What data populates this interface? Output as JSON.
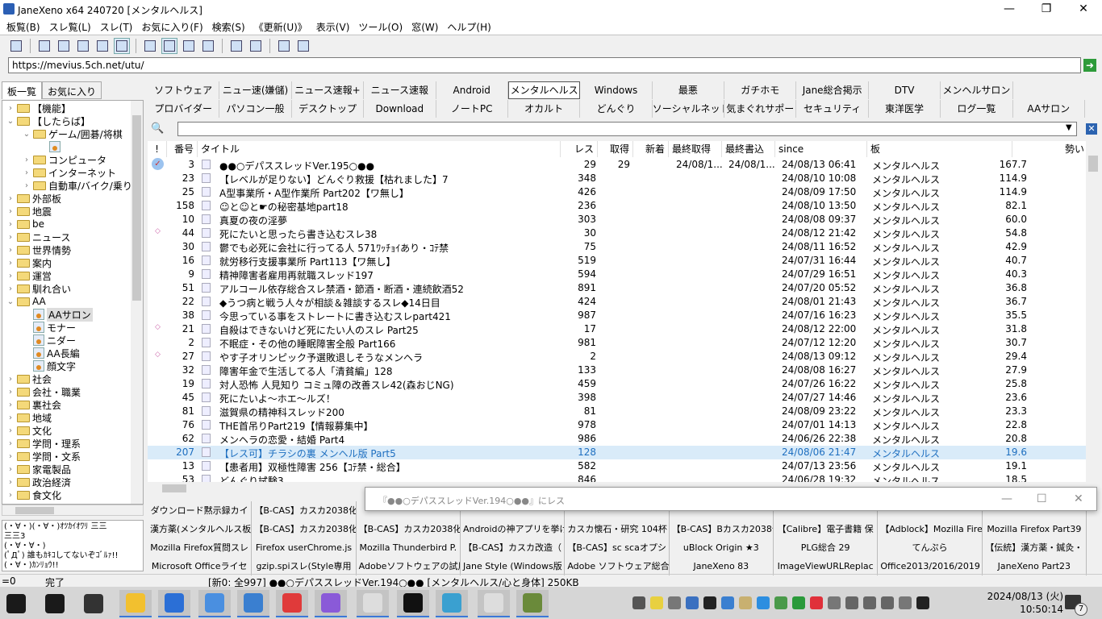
{
  "window": {
    "title": "JaneXeno x64 240720 [メンタルヘルス]",
    "minimize": "—",
    "maximize": "❐",
    "close": "✕"
  },
  "menu": [
    "板覧(B)",
    "スレ覧(L)",
    "スレ(T)",
    "お気に入り(F)",
    "検索(S)",
    "《更新(U)》",
    "表示(V)",
    "ツール(O)",
    "窓(W)",
    "ヘルプ(H)"
  ],
  "address": {
    "url": "https://mevius.5ch.net/utu/",
    "go": "➜"
  },
  "left_tabs": [
    {
      "label": "板一覧",
      "active": true
    },
    {
      "label": "お気に入り",
      "active": false
    }
  ],
  "tree": [
    {
      "label": "【機能】",
      "level": 0,
      "type": "folder",
      "state": "collapsed"
    },
    {
      "label": "【したらば】",
      "level": 0,
      "type": "folder",
      "state": "expanded"
    },
    {
      "label": "ゲーム/囲碁/将棋",
      "level": 1,
      "type": "folder",
      "state": "expanded"
    },
    {
      "label": "",
      "level": 2,
      "type": "board",
      "state": "none"
    },
    {
      "label": "コンピュータ",
      "level": 1,
      "type": "folder",
      "state": "collapsed"
    },
    {
      "label": "インターネット",
      "level": 1,
      "type": "folder",
      "state": "collapsed"
    },
    {
      "label": "自動車/バイク/乗り",
      "level": 1,
      "type": "folder",
      "state": "collapsed"
    },
    {
      "label": "外部板",
      "level": 0,
      "type": "folder",
      "state": "collapsed"
    },
    {
      "label": "地震",
      "level": 0,
      "type": "folder",
      "state": "collapsed"
    },
    {
      "label": "be",
      "level": 0,
      "type": "folder",
      "state": "collapsed"
    },
    {
      "label": "ニュース",
      "level": 0,
      "type": "folder",
      "state": "collapsed"
    },
    {
      "label": "世界情勢",
      "level": 0,
      "type": "folder",
      "state": "collapsed"
    },
    {
      "label": "案内",
      "level": 0,
      "type": "folder",
      "state": "collapsed"
    },
    {
      "label": "運営",
      "level": 0,
      "type": "folder",
      "state": "collapsed"
    },
    {
      "label": "馴れ合い",
      "level": 0,
      "type": "folder",
      "state": "collapsed"
    },
    {
      "label": "AA",
      "level": 0,
      "type": "folder",
      "state": "expanded"
    },
    {
      "label": "AAサロン",
      "level": 1,
      "type": "board",
      "state": "selected"
    },
    {
      "label": "モナー",
      "level": 1,
      "type": "board",
      "state": "none"
    },
    {
      "label": "ニダー",
      "level": 1,
      "type": "board",
      "state": "none"
    },
    {
      "label": "AA長編",
      "level": 1,
      "type": "board",
      "state": "none"
    },
    {
      "label": "顔文字",
      "level": 1,
      "type": "board",
      "state": "none"
    },
    {
      "label": "社会",
      "level": 0,
      "type": "folder",
      "state": "collapsed"
    },
    {
      "label": "会社・職業",
      "level": 0,
      "type": "folder",
      "state": "collapsed"
    },
    {
      "label": "裏社会",
      "level": 0,
      "type": "folder",
      "state": "collapsed"
    },
    {
      "label": "地域",
      "level": 0,
      "type": "folder",
      "state": "collapsed"
    },
    {
      "label": "文化",
      "level": 0,
      "type": "folder",
      "state": "collapsed"
    },
    {
      "label": "学問・理系",
      "level": 0,
      "type": "folder",
      "state": "collapsed"
    },
    {
      "label": "学問・文系",
      "level": 0,
      "type": "folder",
      "state": "collapsed"
    },
    {
      "label": "家電製品",
      "level": 0,
      "type": "folder",
      "state": "collapsed"
    },
    {
      "label": "政治経済",
      "level": 0,
      "type": "folder",
      "state": "collapsed"
    },
    {
      "label": "食文化",
      "level": 0,
      "type": "folder",
      "state": "collapsed"
    }
  ],
  "aa_text": "(・∀・)(・∀・)ｵﾂｶｲｵﾜﾘ 三三\n三三3\n(・∀・∀・)\n(ﾟДﾟ) 誰もｶｷｺしてないぞｺﾞﾙｧ!!\n(・∀・)ｶﾝﾘｮｳ!!",
  "board_tabs": {
    "row1": [
      "ソフトウェア",
      "ニュー速(嫌儲)",
      "ニュース速報+",
      "ニュース速報",
      "Android",
      "メンタルヘルス",
      "Windows",
      "最悪",
      "ガチホモ",
      "Jane総合掲示",
      "DTV",
      "メンヘルサロン"
    ],
    "row2": [
      "プロバイダー",
      "パソコン一般",
      "デスクトップ",
      "Download",
      "ノートPC",
      "オカルト",
      "どんぐり",
      "ソーシャルネット",
      "気まぐれサポー",
      "セキュリティ",
      "東洋医学",
      "ログ一覧",
      "AAサロン"
    ],
    "active": "メンタルヘルス"
  },
  "search": {
    "value": "",
    "placeholder": ""
  },
  "columns": [
    "!",
    "番号",
    "タイトル",
    "レス",
    "取得",
    "新着",
    "最終取得",
    "最終書込",
    "since",
    "板",
    "勢い"
  ],
  "threads": [
    {
      "mark": "check",
      "no": "3",
      "title": "●●○デパススレッドVer.195○●●",
      "res": "29",
      "got": "29",
      "new": "",
      "last_get": "24/08/1...",
      "last_write": "24/08/1...",
      "since": "24/08/13 06:41",
      "board": "メンタルヘルス",
      "ikioi": "167.7"
    },
    {
      "mark": "",
      "no": "23",
      "title": "【レベルが足りない】どんぐり救援【枯れました】7",
      "res": "348",
      "got": "",
      "new": "",
      "last_get": "",
      "last_write": "",
      "since": "24/08/10 10:08",
      "board": "メンタルヘルス",
      "ikioi": "114.9"
    },
    {
      "mark": "",
      "no": "25",
      "title": "A型事業所・A型作業所 Part202【ワ無し】",
      "res": "426",
      "got": "",
      "new": "",
      "last_get": "",
      "last_write": "",
      "since": "24/08/09 17:50",
      "board": "メンタルヘルス",
      "ikioi": "114.9"
    },
    {
      "mark": "",
      "no": "158",
      "title": "☺と☺と☛の秘密基地part18",
      "res": "236",
      "got": "",
      "new": "",
      "last_get": "",
      "last_write": "",
      "since": "24/08/10 13:50",
      "board": "メンタルヘルス",
      "ikioi": "82.1"
    },
    {
      "mark": "",
      "no": "10",
      "title": "真夏の夜の淫夢",
      "res": "303",
      "got": "",
      "new": "",
      "last_get": "",
      "last_write": "",
      "since": "24/08/08 09:37",
      "board": "メンタルヘルス",
      "ikioi": "60.0"
    },
    {
      "mark": "new",
      "no": "44",
      "title": "死にたいと思ったら書き込むスレ38",
      "res": "30",
      "got": "",
      "new": "",
      "last_get": "",
      "last_write": "",
      "since": "24/08/12 21:42",
      "board": "メンタルヘルス",
      "ikioi": "54.8"
    },
    {
      "mark": "",
      "no": "30",
      "title": "鬱でも必死に会社に行ってる人 571ﾜｯﾁｮｲあり・ｺﾃ禁",
      "res": "75",
      "got": "",
      "new": "",
      "last_get": "",
      "last_write": "",
      "since": "24/08/11 16:52",
      "board": "メンタルヘルス",
      "ikioi": "42.9"
    },
    {
      "mark": "",
      "no": "16",
      "title": "就労移行支援事業所 Part113【ワ無し】",
      "res": "519",
      "got": "",
      "new": "",
      "last_get": "",
      "last_write": "",
      "since": "24/07/31 16:44",
      "board": "メンタルヘルス",
      "ikioi": "40.7"
    },
    {
      "mark": "",
      "no": "9",
      "title": "精神障害者雇用再就職スレッド197",
      "res": "594",
      "got": "",
      "new": "",
      "last_get": "",
      "last_write": "",
      "since": "24/07/29 16:51",
      "board": "メンタルヘルス",
      "ikioi": "40.3"
    },
    {
      "mark": "",
      "no": "51",
      "title": "アルコール依存総合スレ禁酒・節酒・断酒・連続飲酒52",
      "res": "891",
      "got": "",
      "new": "",
      "last_get": "",
      "last_write": "",
      "since": "24/07/20 05:52",
      "board": "メンタルヘルス",
      "ikioi": "36.8"
    },
    {
      "mark": "",
      "no": "22",
      "title": "◆うつ病と戦う人々が相談＆雑談するスレ◆14日目",
      "res": "424",
      "got": "",
      "new": "",
      "last_get": "",
      "last_write": "",
      "since": "24/08/01 21:43",
      "board": "メンタルヘルス",
      "ikioi": "36.7"
    },
    {
      "mark": "",
      "no": "38",
      "title": "今思っている事をストレートに書き込むスレpart421",
      "res": "987",
      "got": "",
      "new": "",
      "last_get": "",
      "last_write": "",
      "since": "24/07/16 16:23",
      "board": "メンタルヘルス",
      "ikioi": "35.5"
    },
    {
      "mark": "new",
      "no": "21",
      "title": "自殺はできないけど死にたい人のスレ Part25",
      "res": "17",
      "got": "",
      "new": "",
      "last_get": "",
      "last_write": "",
      "since": "24/08/12 22:00",
      "board": "メンタルヘルス",
      "ikioi": "31.8"
    },
    {
      "mark": "",
      "no": "2",
      "title": "不眠症・その他の睡眠障害全般 Part166",
      "res": "981",
      "got": "",
      "new": "",
      "last_get": "",
      "last_write": "",
      "since": "24/07/12 12:20",
      "board": "メンタルヘルス",
      "ikioi": "30.7"
    },
    {
      "mark": "new",
      "no": "27",
      "title": "やす子オリンピック予選敗退しそうなメンヘラ",
      "res": "2",
      "got": "",
      "new": "",
      "last_get": "",
      "last_write": "",
      "since": "24/08/13 09:12",
      "board": "メンタルヘルス",
      "ikioi": "29.4"
    },
    {
      "mark": "",
      "no": "32",
      "title": "障害年金で生活してる人「清貧編」128",
      "res": "133",
      "got": "",
      "new": "",
      "last_get": "",
      "last_write": "",
      "since": "24/08/08 16:27",
      "board": "メンタルヘルス",
      "ikioi": "27.9"
    },
    {
      "mark": "",
      "no": "19",
      "title": "対人恐怖 人見知り コミュ障の改善スレ42(森おじNG)",
      "res": "459",
      "got": "",
      "new": "",
      "last_get": "",
      "last_write": "",
      "since": "24/07/26 16:22",
      "board": "メンタルヘルス",
      "ikioi": "25.8"
    },
    {
      "mark": "",
      "no": "45",
      "title": "死にたいよ～ホエ～ルズ！",
      "res": "398",
      "got": "",
      "new": "",
      "last_get": "",
      "last_write": "",
      "since": "24/07/27 14:46",
      "board": "メンタルヘルス",
      "ikioi": "23.6"
    },
    {
      "mark": "",
      "no": "81",
      "title": "滋賀県の精神科スレッド200",
      "res": "81",
      "got": "",
      "new": "",
      "last_get": "",
      "last_write": "",
      "since": "24/08/09 23:22",
      "board": "メンタルヘルス",
      "ikioi": "23.3"
    },
    {
      "mark": "",
      "no": "76",
      "title": "THE首吊りPart219【情報募集中】",
      "res": "978",
      "got": "",
      "new": "",
      "last_get": "",
      "last_write": "",
      "since": "24/07/01 14:13",
      "board": "メンタルヘルス",
      "ikioi": "22.8"
    },
    {
      "mark": "",
      "no": "62",
      "title": "メンヘラの恋愛・結婚 Part4",
      "res": "986",
      "got": "",
      "new": "",
      "last_get": "",
      "last_write": "",
      "since": "24/06/26 22:38",
      "board": "メンタルヘルス",
      "ikioi": "20.8"
    },
    {
      "mark": "hover",
      "no": "207",
      "title": "【レス可】チラシの裏 メンヘル版 Part5",
      "res": "128",
      "got": "",
      "new": "",
      "last_get": "",
      "last_write": "",
      "since": "24/08/06 21:47",
      "board": "メンタルヘルス",
      "ikioi": "19.6"
    },
    {
      "mark": "",
      "no": "13",
      "title": "【患者用】双極性障害 256【ｺﾃ禁・総合】",
      "res": "582",
      "got": "",
      "new": "",
      "last_get": "",
      "last_write": "",
      "since": "24/07/13 23:56",
      "board": "メンタルヘルス",
      "ikioi": "19.1"
    },
    {
      "mark": "",
      "no": "53",
      "title": "どんぐり試験3",
      "res": "846",
      "got": "",
      "new": "",
      "last_get": "",
      "last_write": "",
      "since": "24/06/28 19:32",
      "board": "メンタルヘルス",
      "ikioi": "18.5"
    }
  ],
  "popup": {
    "title": "『●●○デパススレッドVer.194○●●』にレス",
    "minimize": "—",
    "maximize": "☐",
    "close": "✕"
  },
  "thread_tabs": [
    [
      "ダウンロード黙示録カイ",
      "【B-CAS】カスカ2038化",
      "",
      "",
      "",
      "",
      "",
      "",
      ""
    ],
    [
      "漢方薬(メンタルヘルス板",
      "【B-CAS】カスカ2038化",
      "【B-CAS】カスカ2038化",
      "Androidの神アプリを挙げ",
      "カスカ懐石・研究 104杯",
      "【B-CAS】Bカスカ2038化",
      "【Calibre】電子書籍 保",
      "【Adblock】Mozilla Fire",
      "Mozilla Firefox Part39"
    ],
    [
      "Mozilla Firefox質問スレ",
      "Firefox userChrome.js",
      "Mozilla Thunderbird P.",
      "【B-CAS】カスカ改造（",
      "【B-CAS】sc scaオプシ",
      "uBlock Origin ★3",
      "PLG総合 29",
      "てんぷら",
      "【伝統】漢方薬・鍼灸・"
    ],
    [
      "Microsoft Officeライセ",
      "gzip.spiスレ(Style専用",
      "Adobeソフトウェアの試用",
      "Jane Style (Windows版",
      "Adobe ソフトウェア総合",
      "JaneXeno 83",
      "ImageViewURLReplac",
      "Office2013/2016/2019",
      "JaneXeno Part23"
    ]
  ],
  "status": {
    "left": "=0",
    "state": "完了",
    "info": "[新0: 全997] ●●○デパススレッドVer.194○●●  [メンタルヘルス/心と身体]  250KB"
  },
  "clock": {
    "date": "2024/08/13 (火)",
    "time": "10:50:14",
    "notifications": "7"
  },
  "colors": {
    "accent": "#2662b8",
    "hover_row": "#d9ebf9",
    "link": "#1e6fc0",
    "taskbar": "#d6d6d6"
  }
}
